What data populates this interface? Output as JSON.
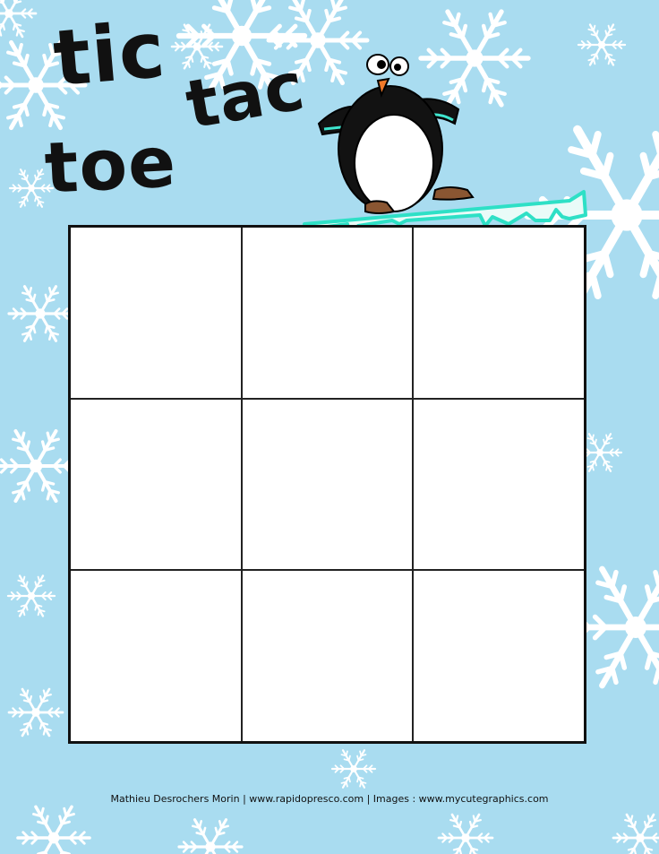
{
  "title": {
    "tic": "tic",
    "tac": "tac",
    "toe": "toe"
  },
  "board": {
    "rows": 3,
    "cols": 3,
    "cells": [
      "",
      "",
      "",
      "",
      "",
      "",
      "",
      "",
      ""
    ]
  },
  "footer": {
    "credits": "Mathieu Desrochers Morin | www.rapidopresco.com | Images : www.mycutegraphics.com"
  },
  "colors": {
    "background": "#a9dcf0",
    "snowflake": "#ffffff",
    "ice": "#3ee6cf",
    "ink": "#111111"
  }
}
